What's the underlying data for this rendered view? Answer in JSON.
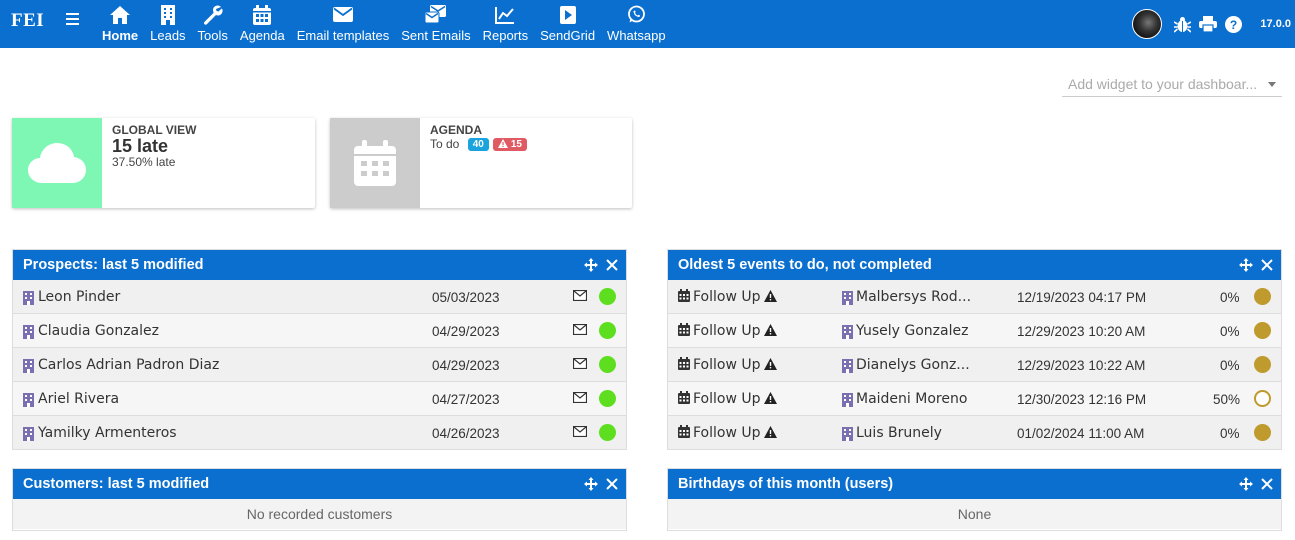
{
  "app": {
    "logo": "FEI",
    "version": "17.0.0"
  },
  "menu": [
    {
      "label": "Home",
      "icon": "home-icon",
      "active": true
    },
    {
      "label": "Leads",
      "icon": "building-icon"
    },
    {
      "label": "Tools",
      "icon": "wrench-icon"
    },
    {
      "label": "Agenda",
      "icon": "calendar-icon"
    },
    {
      "label": "Email templates",
      "icon": "envelope-icon"
    },
    {
      "label": "Sent Emails",
      "icon": "envelopes-icon"
    },
    {
      "label": "Reports",
      "icon": "line-chart-icon"
    },
    {
      "label": "SendGrid",
      "icon": "play-icon"
    },
    {
      "label": "Whatsapp",
      "icon": "whatsapp-icon"
    }
  ],
  "add_widget": {
    "placeholder": "Add widget to your dashboar..."
  },
  "global_view": {
    "title": "GLOBAL VIEW",
    "value": "15 late",
    "sub": "37.50% late",
    "color": "#7ff7b4"
  },
  "agenda_box": {
    "title": "AGENDA",
    "label": "To do",
    "badge_todo": "40",
    "badge_late": "15",
    "color": "#cccccc"
  },
  "prospects": {
    "title": "Prospects: last 5 modified",
    "rows": [
      {
        "name": "Leon Pinder",
        "date": "05/03/2023"
      },
      {
        "name": "Claudia Gonzalez",
        "date": "04/29/2023"
      },
      {
        "name": "Carlos Adrian Padron Diaz",
        "date": "04/29/2023"
      },
      {
        "name": "Ariel Rivera",
        "date": "04/27/2023"
      },
      {
        "name": "Yamilky Armenteros",
        "date": "04/26/2023"
      }
    ]
  },
  "events": {
    "title": "Oldest 5 events to do, not completed",
    "rows": [
      {
        "type": "Follow Up",
        "contact": "Malbersys Rod...",
        "datetime": "12/19/2023 04:17 PM",
        "progress": "0%",
        "status": "filled"
      },
      {
        "type": "Follow Up",
        "contact": "Yusely Gonzalez",
        "datetime": "12/29/2023 10:20 AM",
        "progress": "0%",
        "status": "filled"
      },
      {
        "type": "Follow Up",
        "contact": "Dianelys Gonz...",
        "datetime": "12/29/2023 10:22 AM",
        "progress": "0%",
        "status": "filled"
      },
      {
        "type": "Follow Up",
        "contact": "Maideni Moreno",
        "datetime": "12/30/2023 12:16 PM",
        "progress": "50%",
        "status": "empty"
      },
      {
        "type": "Follow Up",
        "contact": "Luis Brunely",
        "datetime": "01/02/2024 11:00 AM",
        "progress": "0%",
        "status": "filled"
      }
    ]
  },
  "customers": {
    "title": "Customers: last 5 modified",
    "empty": "No recorded customers"
  },
  "birthdays": {
    "title": "Birthdays of this month (users)",
    "empty": "None"
  },
  "colors": {
    "brand": "#0a6fce",
    "status_green": "#5ddf1f",
    "status_gold": "#bf9a2c",
    "badge_blue": "#1aa3dc",
    "badge_red": "#e05a64"
  }
}
